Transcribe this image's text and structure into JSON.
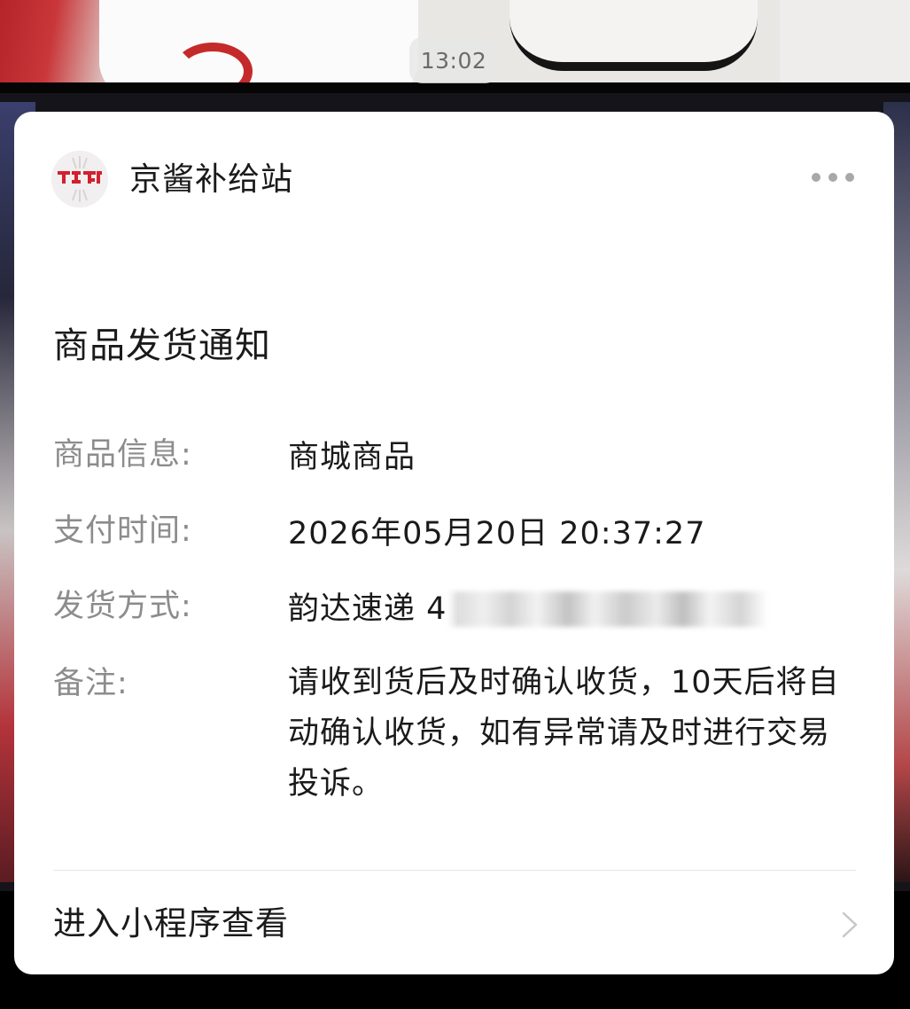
{
  "timestamp": "13:02",
  "card": {
    "store_name": "京酱补给站",
    "logo_icon": "store-logo-icon",
    "more_icon": "more-icon",
    "notice_title": "商品发货通知",
    "fields": [
      {
        "label": "商品信息:",
        "value": "商城商品"
      },
      {
        "label": "支付时间:",
        "value": "2026年05月20日 20:37:27"
      },
      {
        "label": "发货方式:",
        "value": "韵达速递 4"
      },
      {
        "label": "备注:",
        "value": "请收到货后及时确认收货，10天后将自动确认收货，如有异常请及时进行交易投诉。"
      }
    ],
    "footer_link": "进入小程序查看",
    "footer_icon": "chevron-right-icon"
  },
  "colors": {
    "card_background": "#ffffff",
    "label_text": "#8c8c8c",
    "value_text": "#1a1a1a",
    "logo_red": "#d2202f"
  }
}
